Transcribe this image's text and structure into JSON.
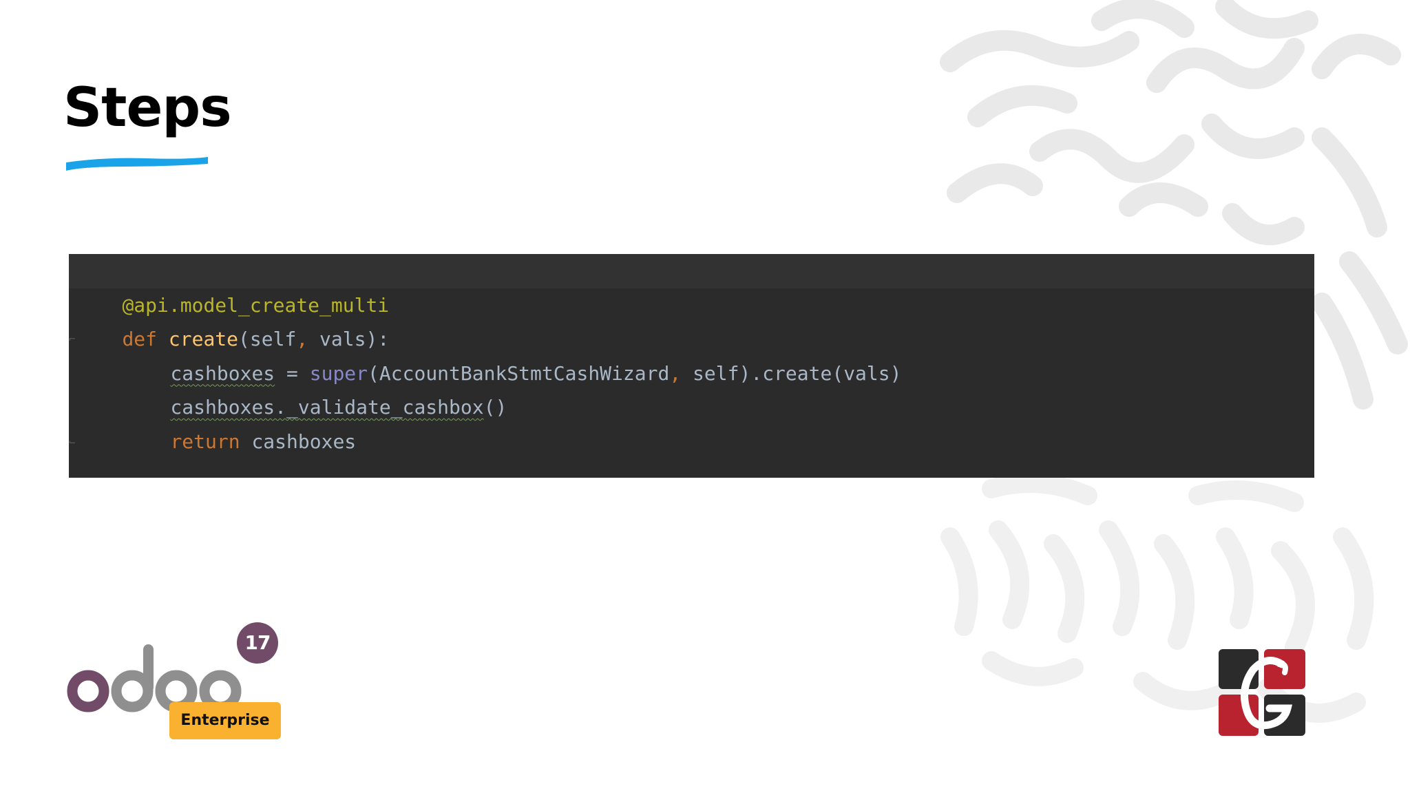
{
  "slide": {
    "title": "Steps"
  },
  "code": {
    "lines": [
      {
        "decorator": "@api.model_create_multi"
      },
      {
        "kw": "def",
        "fn": "create",
        "args": "(self",
        "sep": ",",
        "rest": " vals):"
      },
      {
        "var": "cashboxes",
        "eq": " = ",
        "builtin": "super",
        "open": "(AccountBankStmtCashWizard",
        "sep": ",",
        "rest": " self).create(vals)"
      },
      {
        "call": "cashboxes._validate_cashbox",
        "rest": "()"
      },
      {
        "kw": "return",
        "rest": " cashboxes"
      }
    ]
  },
  "branding": {
    "product": "odoo",
    "version": "17",
    "edition": "Enterprise",
    "colors": {
      "odoo_purple": "#714b67",
      "odoo_grey": "#8f8f8f",
      "enterprise_yellow": "#fbb130",
      "underline_blue": "#1aa3e8",
      "logo_red": "#b8232f",
      "logo_dark": "#2b2b2b"
    }
  }
}
